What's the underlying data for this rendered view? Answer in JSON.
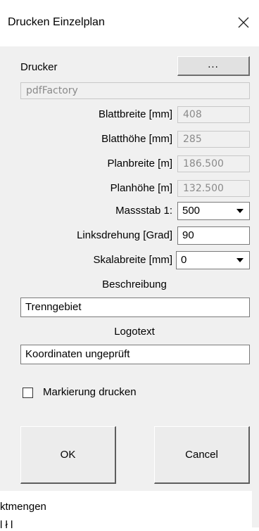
{
  "dialog": {
    "title": "Drucken Einzelplan",
    "printer_label": "Drucker",
    "printer_button": "...",
    "printer_value": "pdfFactory",
    "fields": {
      "blattbreite": {
        "label": "Blattbreite [mm]",
        "value": "408"
      },
      "blatthoehe": {
        "label": "Blatthöhe [mm]",
        "value": "285"
      },
      "planbreite": {
        "label": "Planbreite [m]",
        "value": "186.500"
      },
      "planhoehe": {
        "label": "Planhöhe [m]",
        "value": "132.500"
      },
      "massstab": {
        "label": "Massstab 1:",
        "value": "500"
      },
      "linksdrehung": {
        "label": "Linksdrehung [Grad]",
        "value": "90"
      },
      "skalabreite": {
        "label": "Skalabreite [mm]",
        "value": "0"
      }
    },
    "beschreibung_label": "Beschreibung",
    "beschreibung_value": "Trenngebiet",
    "logotext_label": "Logotext",
    "logotext_value": "Koordinaten ungeprüft",
    "checkbox_label": "Markierung drucken",
    "checkbox_checked": false,
    "ok_label": "OK",
    "cancel_label": "Cancel"
  },
  "background": {
    "line1": "ktmengen",
    "line2": "l ł l"
  },
  "icons": [
    "close-icon",
    "dropdown-arrow-icon"
  ]
}
